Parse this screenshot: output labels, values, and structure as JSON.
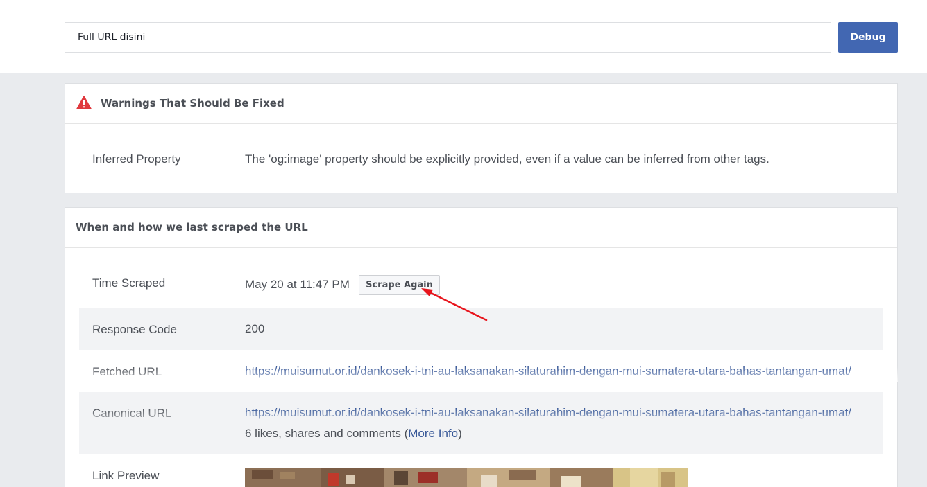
{
  "search": {
    "value": "Full URL disini",
    "button_label": "Debug"
  },
  "warnings": {
    "title": "Warnings That Should Be Fixed",
    "rows": [
      {
        "label": "Inferred Property",
        "value": "The 'og:image' property should be explicitly provided, even if a value can be inferred from other tags."
      }
    ]
  },
  "scrape": {
    "title": "When and how we last scraped the URL",
    "time_label": "Time Scraped",
    "time_value": "May 20 at 11:47 PM",
    "scrape_button": "Scrape Again",
    "response_label": "Response Code",
    "response_value": "200",
    "fetched_label": "Fetched URL",
    "fetched_value": "https://muisumut.or.id/dankosek-i-tni-au-laksanakan-silaturahim-dengan-mui-sumatera-utara-bahas-tantangan-umat/",
    "canonical_label": "Canonical URL",
    "canonical_value": "https://muisumut.or.id/dankosek-i-tni-au-laksanakan-silaturahim-dengan-mui-sumatera-utara-bahas-tantangan-umat/",
    "likes_text": "6 likes, shares and comments (",
    "more_info": "More Info",
    "likes_close": ")",
    "preview_label": "Link Preview"
  },
  "colors": {
    "accent": "#4267b2",
    "warning": "#e0393e",
    "annotation_arrow": "#e8141c"
  },
  "icons": {
    "warning": "warning-triangle-icon"
  }
}
